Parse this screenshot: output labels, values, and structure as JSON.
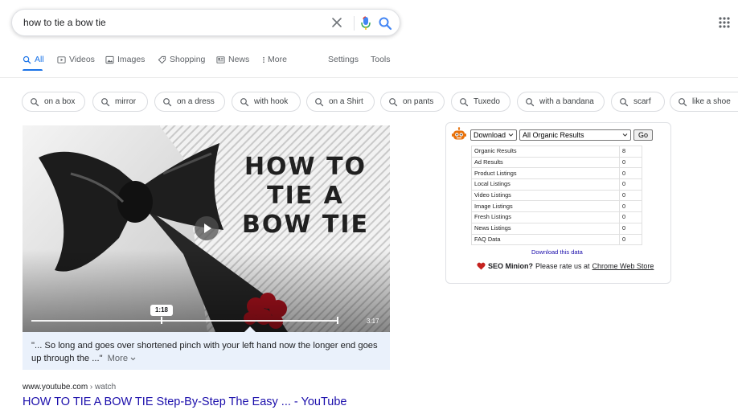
{
  "search": {
    "query": "how to tie a bow tie"
  },
  "tabs": [
    {
      "label": "All",
      "icon": "search-icon"
    },
    {
      "label": "Videos",
      "icon": "video-icon"
    },
    {
      "label": "Images",
      "icon": "image-icon"
    },
    {
      "label": "Shopping",
      "icon": "tag-icon"
    },
    {
      "label": "News",
      "icon": "news-icon"
    },
    {
      "label": "More",
      "icon": "more-vert-icon"
    },
    {
      "label": "Settings"
    },
    {
      "label": "Tools"
    }
  ],
  "chips": [
    "on a box",
    "mirror",
    "on a dress",
    "with hook",
    "on a Shirt",
    "on pants",
    "Tuxedo",
    "with a bandana",
    "scarf",
    "like a shoe"
  ],
  "video": {
    "overlay_title": [
      "HOW TO",
      "TIE A",
      "BOW TIE"
    ],
    "current_time": "1:18",
    "duration": "3:17",
    "progress": 0.45
  },
  "snippet": {
    "text": "\"... So long and goes over shortened pinch with your left hand now the longer end goes up through the ...\"",
    "more_label": "More"
  },
  "result": {
    "site": "www.youtube.com",
    "crumb": " › watch",
    "title": "HOW TO TIE A BOW TIE Step-By-Step The Easy ... - YouTube"
  },
  "seo_minion": {
    "action_select": "Download",
    "filter_select": "All Organic Results",
    "go_label": "Go",
    "rows": [
      {
        "label": "Organic Results",
        "value": "8"
      },
      {
        "label": "Ad Results",
        "value": "0"
      },
      {
        "label": "Product Listings",
        "value": "0"
      },
      {
        "label": "Local Listings",
        "value": "0"
      },
      {
        "label": "Video Listings",
        "value": "0"
      },
      {
        "label": "Image Listings",
        "value": "0"
      },
      {
        "label": "Fresh Listings",
        "value": "0"
      },
      {
        "label": "News Listings",
        "value": "0"
      },
      {
        "label": "FAQ Data",
        "value": "0"
      }
    ],
    "download_link": "Download this data",
    "brand": "SEO Minion?",
    "rate_text": "Please rate us at",
    "store_link": "Chrome Web Store"
  },
  "colors": {
    "accent": "#1a73e8",
    "link": "#1a0dab",
    "snippet_bg": "#eaf1fb",
    "heart": "#c5221f"
  }
}
